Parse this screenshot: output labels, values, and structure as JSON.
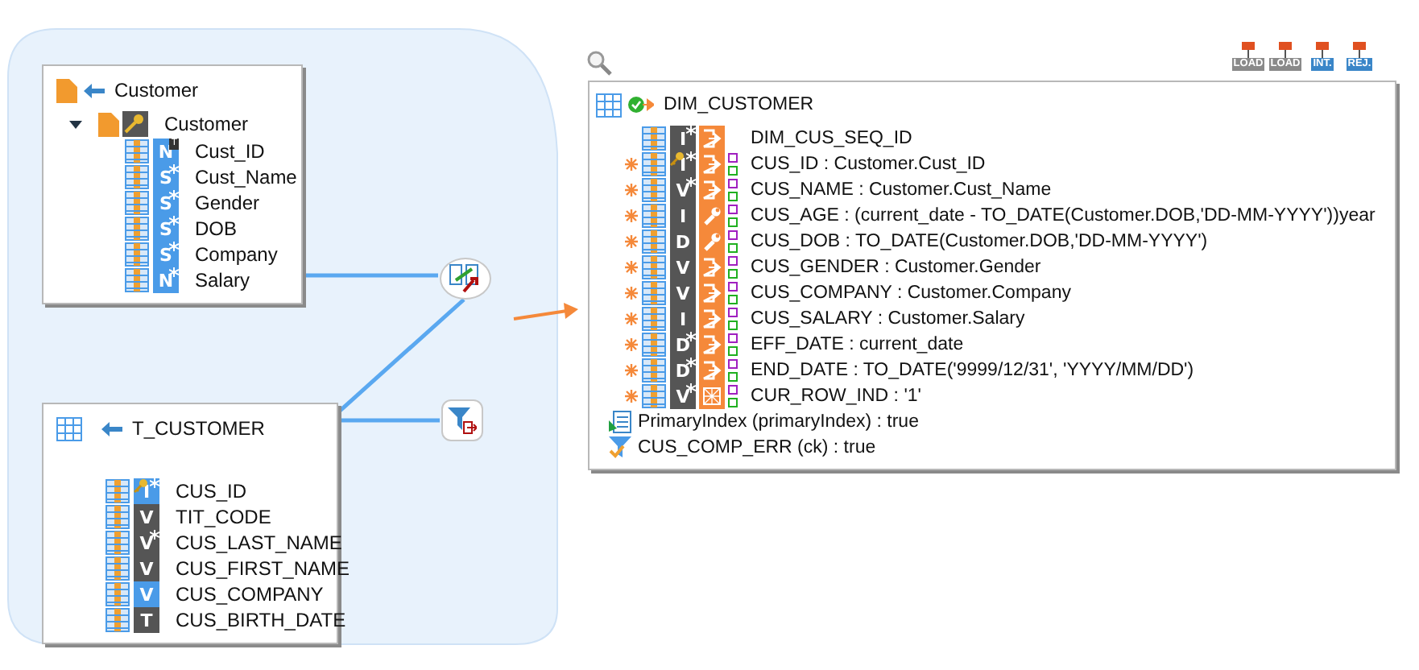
{
  "source_tables": [
    {
      "title": "Customer",
      "kind": "file",
      "tree": {
        "label": "Customer",
        "expanded": true
      },
      "columns": [
        {
          "name": "Cust_ID",
          "type": "N",
          "color": "#4a9be8",
          "star": false,
          "key": false,
          "tag": "T"
        },
        {
          "name": "Cust_Name",
          "type": "S",
          "color": "#4a9be8",
          "star": true,
          "key": false
        },
        {
          "name": "Gender",
          "type": "S",
          "color": "#4a9be8",
          "star": true,
          "key": false
        },
        {
          "name": "DOB",
          "type": "S",
          "color": "#4a9be8",
          "star": true,
          "key": false
        },
        {
          "name": "Company",
          "type": "S",
          "color": "#4a9be8",
          "star": true,
          "key": false
        },
        {
          "name": "Salary",
          "type": "N",
          "color": "#4a9be8",
          "star": true,
          "key": false
        }
      ]
    },
    {
      "title": "T_CUSTOMER",
      "kind": "table",
      "columns": [
        {
          "name": "CUS_ID",
          "type": "I",
          "color": "#4a9be8",
          "star": true,
          "key": true
        },
        {
          "name": "TIT_CODE",
          "type": "V",
          "color": "#555555",
          "star": false,
          "key": false
        },
        {
          "name": "CUS_LAST_NAME",
          "type": "V",
          "color": "#555555",
          "star": true,
          "key": false
        },
        {
          "name": "CUS_FIRST_NAME",
          "type": "V",
          "color": "#555555",
          "star": false,
          "key": false
        },
        {
          "name": "CUS_COMPANY",
          "type": "V",
          "color": "#4a9be8",
          "star": false,
          "key": false
        },
        {
          "name": "CUS_BIRTH_DATE",
          "type": "T",
          "color": "#555555",
          "star": false,
          "key": false
        }
      ]
    }
  ],
  "stamps": [
    {
      "label": "LOAD",
      "color": "#8a8a8a"
    },
    {
      "label": "LOAD",
      "color": "#8a8a8a"
    },
    {
      "label": "INT.",
      "color": "#3a86c8"
    },
    {
      "label": "REJ.",
      "color": "#3a86c8"
    }
  ],
  "target": {
    "title": "DIM_CUSTOMER",
    "columns": [
      {
        "text": "DIM_CUS_SEQ_ID",
        "type": "I",
        "star": true,
        "key": false,
        "kind": "output",
        "mapped": false,
        "flags": false
      },
      {
        "text": "CUS_ID : Customer.Cust_ID",
        "type": "I",
        "star": true,
        "key": true,
        "kind": "output",
        "mapped": true,
        "flags": true
      },
      {
        "text": "CUS_NAME : Customer.Cust_Name",
        "type": "V",
        "star": true,
        "key": false,
        "kind": "output",
        "mapped": true,
        "flags": true
      },
      {
        "text": "CUS_AGE : (current_date - TO_DATE(Customer.DOB,'DD-MM-YYYY'))year",
        "type": "I",
        "star": false,
        "key": false,
        "kind": "expression",
        "mapped": true,
        "flags": true
      },
      {
        "text": "CUS_DOB : TO_DATE(Customer.DOB,'DD-MM-YYYY')",
        "type": "D",
        "star": false,
        "key": false,
        "kind": "expression",
        "mapped": true,
        "flags": true
      },
      {
        "text": "CUS_GENDER : Customer.Gender",
        "type": "V",
        "star": false,
        "key": false,
        "kind": "output",
        "mapped": true,
        "flags": true
      },
      {
        "text": "CUS_COMPANY : Customer.Company",
        "type": "V",
        "star": false,
        "key": false,
        "kind": "output",
        "mapped": true,
        "flags": true
      },
      {
        "text": "CUS_SALARY : Customer.Salary",
        "type": "I",
        "star": false,
        "key": false,
        "kind": "output",
        "mapped": true,
        "flags": true
      },
      {
        "text": "EFF_DATE : current_date",
        "type": "D",
        "star": true,
        "key": false,
        "kind": "output",
        "mapped": true,
        "flags": true
      },
      {
        "text": "END_DATE : TO_DATE('9999/12/31', 'YYYY/MM/DD')",
        "type": "D",
        "star": true,
        "key": false,
        "kind": "output",
        "mapped": true,
        "flags": true
      },
      {
        "text": "CUR_ROW_IND : '1'",
        "type": "V",
        "star": true,
        "key": false,
        "kind": "constant",
        "mapped": true,
        "flags": true
      }
    ],
    "constraints": [
      {
        "kind": "index",
        "text": "PrimaryIndex (primaryIndex)  : true"
      },
      {
        "kind": "check",
        "text": "CUS_COMP_ERR (ck)  : true"
      }
    ]
  }
}
